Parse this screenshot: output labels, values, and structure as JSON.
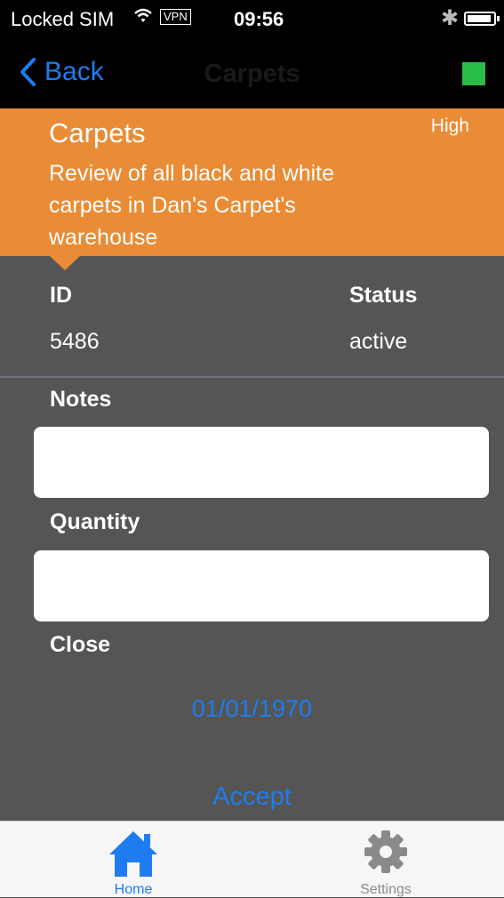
{
  "status_bar": {
    "carrier": "Locked SIM",
    "vpn": "VPN",
    "time": "09:56"
  },
  "nav": {
    "back_label": "Back",
    "title": "Carpets",
    "indicator_color": "#2bbd4a"
  },
  "header": {
    "title": "Carpets",
    "priority": "High",
    "description": "Review of all black and white carpets in Dan's Carpet's warehouse",
    "color": "#e98c35"
  },
  "details": {
    "id_label": "ID",
    "id_value": "5486",
    "status_label": "Status",
    "status_value": "active"
  },
  "form": {
    "notes_label": "Notes",
    "notes_value": "",
    "quantity_label": "Quantity",
    "quantity_value": "",
    "close_label": "Close",
    "close_date": "01/01/1970",
    "accept_label": "Accept"
  },
  "tabs": [
    {
      "label": "Home",
      "icon": "home-icon",
      "active": true
    },
    {
      "label": "Settings",
      "icon": "gear-icon",
      "active": false
    }
  ],
  "accent_color": "#1e7cf0"
}
